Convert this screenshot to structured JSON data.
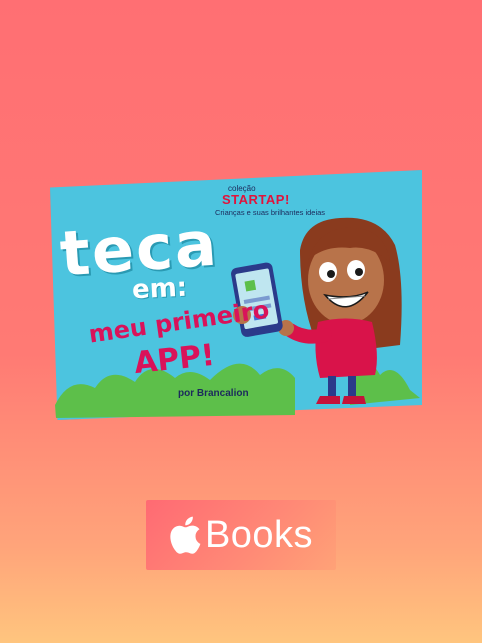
{
  "cover": {
    "collection_label": "coleção",
    "collection_name": "STARTAP!",
    "collection_subtitle": "Crianças e suas brilhantes ideias",
    "title": "teca",
    "title_connector": "em:",
    "subtitle_line1": "meu primeiro",
    "subtitle_line2": "APP!",
    "author": "por Brancalion"
  },
  "badge": {
    "icon": "apple-logo-icon",
    "label": "Books"
  },
  "colors": {
    "background_top": "#ff6f73",
    "background_bottom": "#ffc57e",
    "cover_blue": "#4cc4df",
    "title_pink": "#d9135a",
    "brand_red": "#e0143c"
  }
}
